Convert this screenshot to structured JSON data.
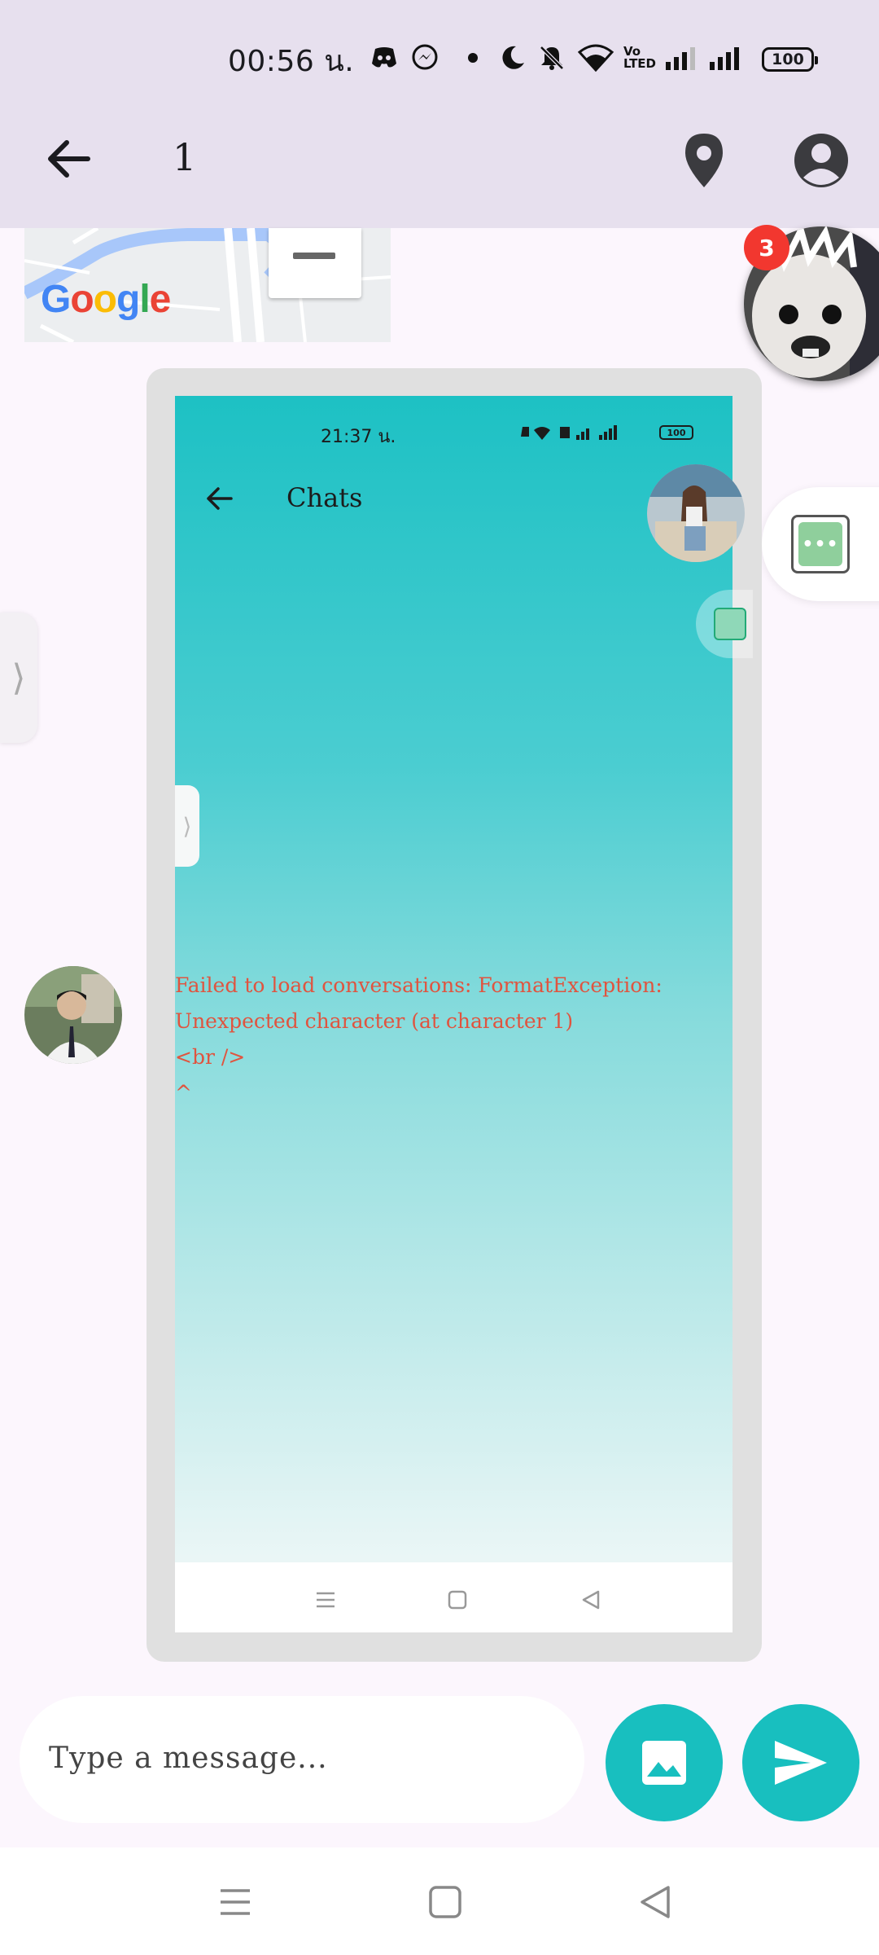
{
  "status_bar": {
    "time": "00:56 น.",
    "icons": [
      "discord-icon",
      "messenger-icon",
      "dot-icon",
      "moon-icon",
      "bell-off-icon",
      "wifi-icon",
      "volte-icon",
      "signal-icon",
      "signal-icon"
    ],
    "volte": "Vo\nLTED",
    "battery": "100"
  },
  "app_bar": {
    "title": "1",
    "icons": [
      "back-arrow-icon",
      "location-pin-icon",
      "account-circle-icon"
    ]
  },
  "map": {
    "logo": "Google"
  },
  "floating": {
    "badge_count": "3",
    "chat_head_dots": "•••",
    "edge_tab_glyph": "⟩"
  },
  "message": {
    "image": {
      "status_time": "21:37 น.",
      "battery": "100",
      "title": "Chats",
      "edge_tab_glyph": "⟩",
      "error_text": "Failed to load conversations: FormatException:\nUnexpected character (at character 1)\n<br />\n^"
    }
  },
  "composer": {
    "placeholder": "Type a message..."
  },
  "colors": {
    "accent": "#18bfbf",
    "app_bar": "#e7e0ee",
    "background": "#fcf6fd",
    "error": "#e0543f",
    "badge": "#f2372f"
  }
}
